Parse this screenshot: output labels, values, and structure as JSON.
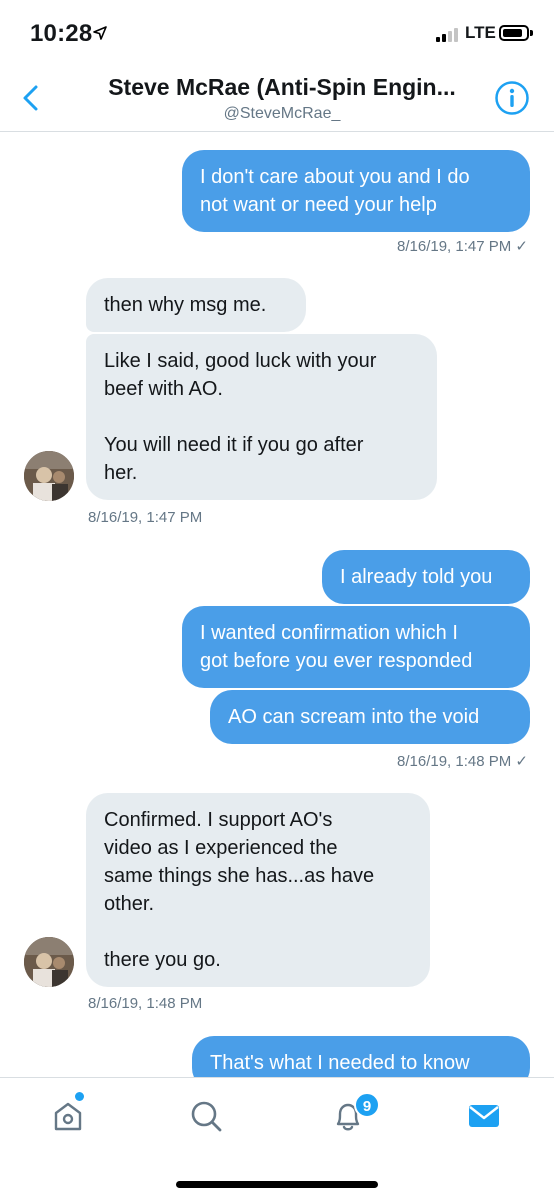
{
  "status_bar": {
    "time": "10:28",
    "carrier": "LTE",
    "icons": [
      "location-arrow-icon",
      "signal-bars-icon",
      "battery-icon"
    ]
  },
  "header": {
    "title": "Steve McRae (Anti-Spin Engin...",
    "handle": "@SteveMcRae_",
    "back_icon": "chevron-left-icon",
    "info_icon": "info-circle-icon",
    "accent_color": "#1da1f2"
  },
  "messages": [
    {
      "direction": "outgoing",
      "text": "I don't care about you and I do\nnot want or need your help"
    },
    {
      "direction": "incoming",
      "text": "then why msg me."
    },
    {
      "direction": "incoming",
      "text": "Like I said, good luck with your\nbeef with AO.\n\nYou will need it if you go after\nher."
    },
    {
      "direction": "outgoing",
      "text": "I already told you"
    },
    {
      "direction": "outgoing",
      "text": "I wanted confirmation which I\ngot before you ever responded"
    },
    {
      "direction": "outgoing",
      "text": "AO can scream into the void"
    },
    {
      "direction": "incoming",
      "text": "Confirmed. I support AO's\nvideo as I experienced the\nsame things she has...as have\nother.\n\nthere you go."
    },
    {
      "direction": "outgoing",
      "text": "That's what I needed to know"
    }
  ],
  "timestamps": {
    "t1": "8/16/19, 1:47 PM ✓",
    "t2": "8/16/19, 1:47 PM",
    "t3": "8/16/19, 1:48 PM ✓",
    "t4": "8/16/19, 1:48 PM"
  },
  "colors": {
    "outgoing_bubble": "#4a9ee8",
    "incoming_bubble": "#e6ecf0",
    "timestamp": "#657786"
  },
  "tab_bar": {
    "tabs": [
      "home-icon",
      "search-icon",
      "notifications-bell-icon",
      "messages-envelope-icon"
    ],
    "notification_count": "9",
    "active_tab": "messages"
  }
}
